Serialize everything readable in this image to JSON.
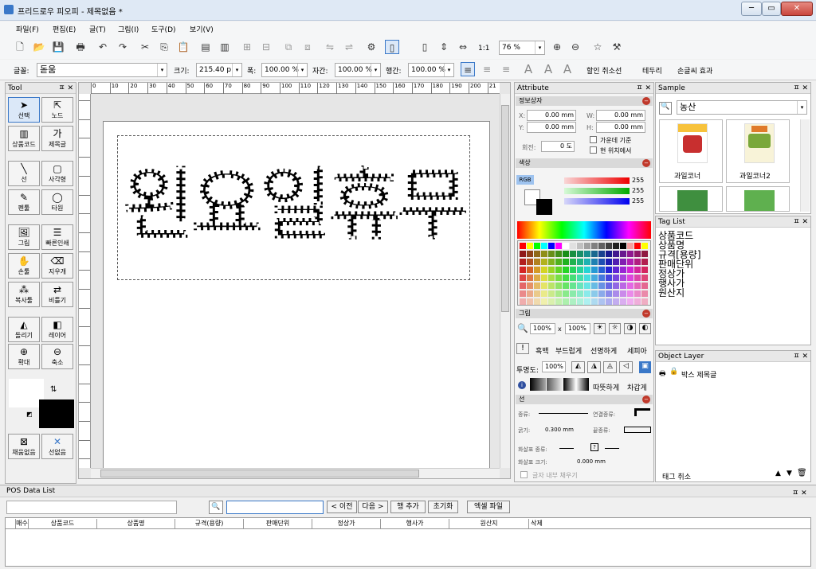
{
  "window": {
    "title": "프리드로우 피오피 - 제목없음 *",
    "min": "─",
    "max": "▭",
    "close": "✕"
  },
  "menu": [
    "파일(F)",
    "편집(E)",
    "글(T)",
    "그림(I)",
    "도구(D)",
    "보기(V)"
  ],
  "toolbar": {
    "zoom_label": "1:1",
    "zoom_value": "76 %"
  },
  "fontbar": {
    "font_label": "글꼴:",
    "font_value": "돋움",
    "size_label": "크기:",
    "size_value": "215.40 p",
    "width_label": "폭:",
    "width_value": "100.00 %",
    "spacing_label": "자간:",
    "spacing_value": "100.00 %",
    "line_label": "행간:",
    "line_value": "100.00 %",
    "discount_cancel": "할인 취소선",
    "border": "테두리",
    "handwriting_effect": "손글씨 효과"
  },
  "tool_panel": {
    "title": "Tool",
    "tools": [
      {
        "label": "선택",
        "icon": "arrow-icon"
      },
      {
        "label": "노드",
        "icon": "node-icon"
      },
      {
        "label": "상품코드",
        "icon": "barcode-icon"
      },
      {
        "label": "제목글",
        "icon": "text-icon"
      },
      {
        "label": "선",
        "icon": "line-icon"
      },
      {
        "label": "사각형",
        "icon": "rectangle-icon"
      },
      {
        "label": "펜툴",
        "icon": "pen-icon"
      },
      {
        "label": "타원",
        "icon": "ellipse-icon"
      },
      {
        "label": "그림",
        "icon": "image-icon"
      },
      {
        "label": "빠른인쇄",
        "icon": "list-icon"
      },
      {
        "label": "손툴",
        "icon": "hand-icon"
      },
      {
        "label": "지우개",
        "icon": "eraser-icon"
      },
      {
        "label": "복사툴",
        "icon": "copy-icon"
      },
      {
        "label": "비틀기",
        "icon": "twist-icon"
      },
      {
        "label": "돌리기",
        "icon": "rotate-icon"
      },
      {
        "label": "레이어",
        "icon": "layer-icon"
      },
      {
        "label": "확대",
        "icon": "zoom-in-icon"
      },
      {
        "label": "축소",
        "icon": "zoom-out-icon"
      }
    ],
    "fill_none": "채움없음",
    "line_none": "선없음"
  },
  "ruler": [
    "0",
    "10",
    "20",
    "30",
    "40",
    "50",
    "60",
    "70",
    "80",
    "90",
    "100",
    "110",
    "120",
    "130",
    "140",
    "150",
    "160",
    "170",
    "180",
    "190",
    "200",
    "21"
  ],
  "canvas": {
    "text": "왼요일휴무"
  },
  "attribute": {
    "title": "Attribute",
    "info_section": "정보상자",
    "x_label": "X:",
    "x_value": "0.00 mm",
    "y_label": "Y:",
    "y_value": "0.00 mm",
    "w_label": "W:",
    "w_value": "0.00 mm",
    "h_label": "H:",
    "h_value": "0.00 mm",
    "rotate_label": "회전:",
    "rotate_value": "0 도",
    "center_check": "가운데 기준",
    "keep_check": "현 위치에서",
    "color_section": "색상",
    "rgb": "RGB",
    "r": "255",
    "g": "255",
    "b": "255",
    "image_section": "그림",
    "img_w": "100%",
    "img_x": "x",
    "img_h": "100%",
    "effects": [
      "흑백",
      "부드럽게",
      "선명하게",
      "세피아"
    ],
    "opacity_label": "투명도:",
    "opacity_value": "100%",
    "gradient_labels": [
      "따뜻하게",
      "차갑게"
    ],
    "line_section": "선",
    "line_type": "종류:",
    "line_end": "연결종류:",
    "line_width": "굵기:",
    "line_width_value": "0.300 mm",
    "line_tail": "끝종류:",
    "arrow_type": "화살표 종류:",
    "arrow_size": "화살표 크기:",
    "arrow_size_value": "0.000 mm",
    "fill_inside": "글자 내부 채우기"
  },
  "sample": {
    "title": "Sample",
    "category": "농산",
    "items": [
      {
        "label": "과일코너"
      },
      {
        "label": "과일코너2"
      }
    ]
  },
  "tag_list": {
    "title": "Tag List",
    "items": [
      "상품코드",
      "상품명",
      "규격[용량]",
      "판매단위",
      "정상가",
      "행사가",
      "원산지"
    ]
  },
  "object_layer": {
    "title": "Object Layer",
    "item": "박스 제목글",
    "tag_cancel": "태그 취소"
  },
  "pos": {
    "title": "POS Data List",
    "prev": "< 이전",
    "next": "다음 >",
    "add_row": "행 추가",
    "reset": "초기화",
    "excel": "엑셀 파일",
    "columns": [
      "매수",
      "상품코드",
      "상품명",
      "규격(용량)",
      "판매단위",
      "정상가",
      "행사가",
      "원산지",
      "삭제"
    ]
  },
  "colors": {
    "accent": "#2f6fd0",
    "close_red": "#c9463d"
  }
}
